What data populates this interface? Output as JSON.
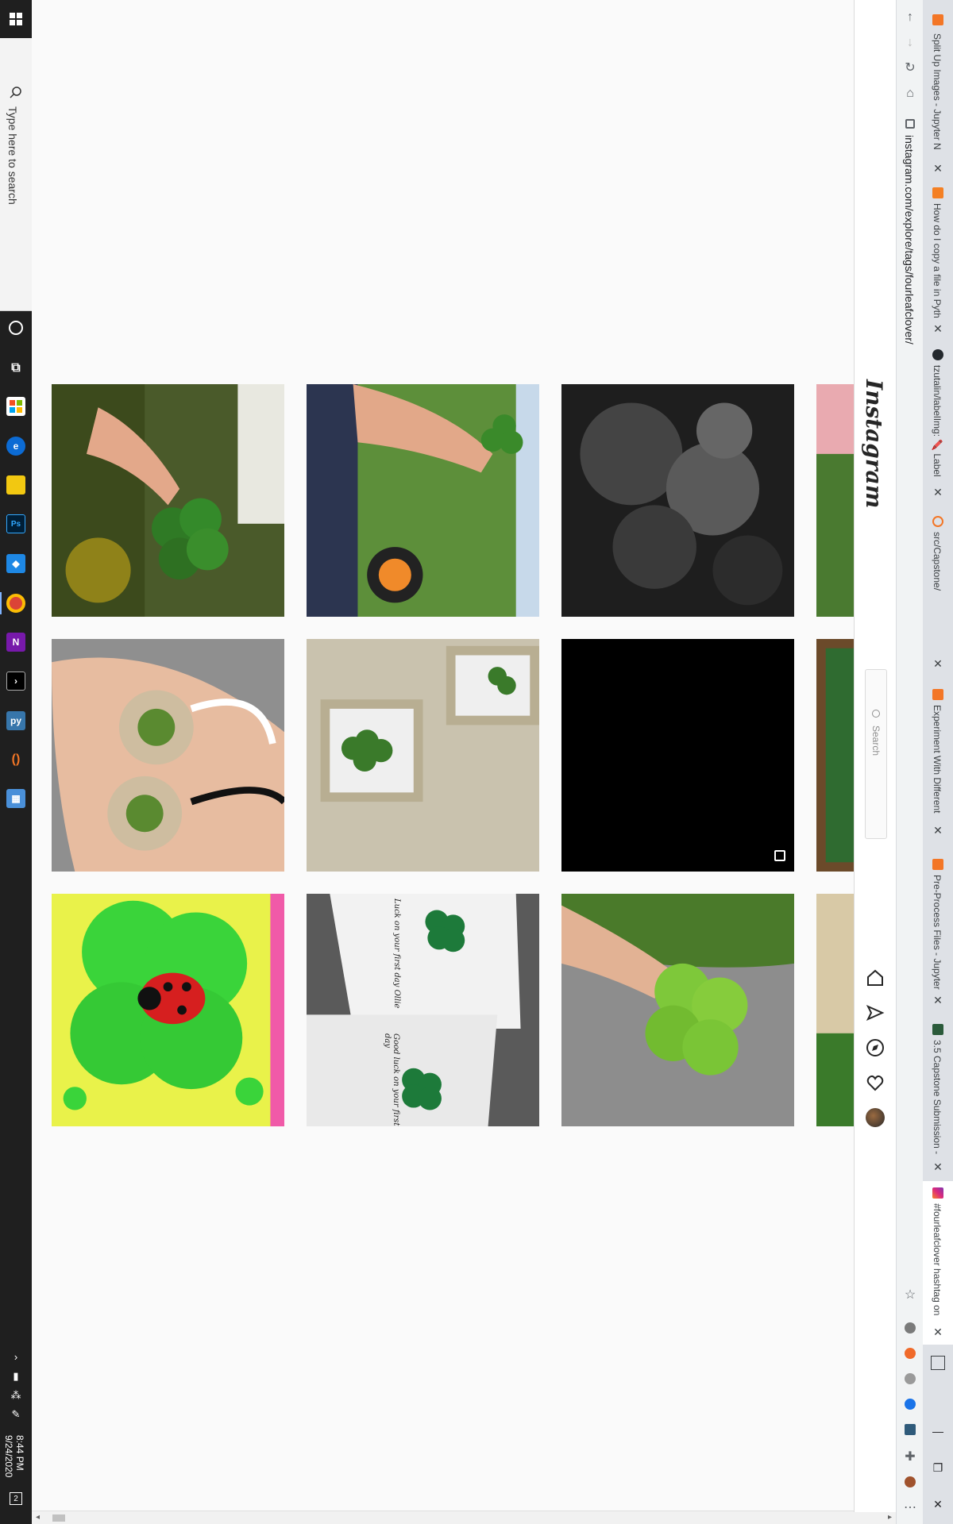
{
  "taskbar": {
    "search_placeholder": "Type here to search",
    "time": "8:44 PM",
    "date": "9/24/2020",
    "notification_count": "2"
  },
  "browser": {
    "url": "instagram.com/explore/tags/fourleafclover/",
    "tabs": [
      {
        "title": "Split Up Images - Jupyter N",
        "active": false
      },
      {
        "title": "How do I copy a file in Pyth",
        "active": false
      },
      {
        "title": "tzutalin/labelImg: 🖍️ Label",
        "active": false
      },
      {
        "title": "src/Capstone/",
        "active": false
      },
      {
        "title": "Experiment With Different",
        "active": false
      },
      {
        "title": "Pre-Process Files - Jupyter N",
        "active": false
      },
      {
        "title": "3.5 Capstone Submission -",
        "active": false
      },
      {
        "title": "#fourleafclover hashtag on",
        "active": true
      }
    ]
  },
  "instagram": {
    "logo": "Instagram",
    "search_placeholder": "Search",
    "nav_icons": [
      "home-icon",
      "direct-message-icon",
      "explore-icon",
      "activity-heart-icon",
      "profile-avatar"
    ]
  },
  "grid": {
    "posts": [
      {
        "desc": "four-leaf clover held in fingers",
        "type": "photo"
      },
      {
        "desc": "hand holding clover by fire pit",
        "type": "photo"
      },
      {
        "desc": "black and white clover leaves",
        "type": "photo"
      },
      {
        "desc": "clover resin pendants in palm",
        "type": "photo"
      },
      {
        "desc": "pressed clovers in ornate frames",
        "type": "photo"
      },
      {
        "desc": "black video tile",
        "type": "video"
      },
      {
        "desc": "ladybug on green clover artwork",
        "type": "photo"
      },
      {
        "desc": "greeting cards with clovers",
        "type": "photo"
      },
      {
        "desc": "four-leaf clover held over pavement",
        "type": "photo"
      }
    ],
    "card_text_1": "Luck on your first day Ollie",
    "card_text_2": "Good luck on your first day"
  },
  "colors": {
    "clover_green": "#3f8f2a",
    "taskbar": "#1f1f1f",
    "ig_border": "#dbdbdb"
  }
}
